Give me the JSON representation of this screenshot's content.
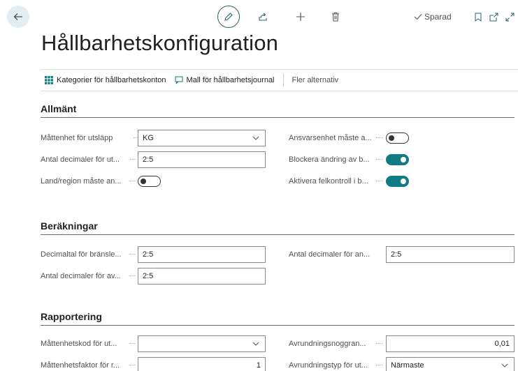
{
  "header": {
    "saved_label": "Sparad",
    "title": "Hållbarhetskonfiguration"
  },
  "actions": {
    "categories": "Kategorier för hållbarhetskonton",
    "template": "Mall för hållbarhetsjournal",
    "more": "Fler alternativ"
  },
  "sections": {
    "general": {
      "title": "Allmänt",
      "emission_unit_label": "Måttenhet för utsläpp",
      "emission_unit_value": "KG",
      "decimals_label": "Antal decimaler för ut...",
      "decimals_value": "2:5",
      "country_label": "Land/region måste an...",
      "country_on": false,
      "responsibility_label": "Ansvarsenhet måste a...",
      "responsibility_on": false,
      "block_label": "Blockera ändring av b...",
      "block_on": true,
      "errorcheck_label": "Aktivera felkontroll i b...",
      "errorcheck_on": true
    },
    "calculations": {
      "title": "Beräkningar",
      "fuel_label": "Decimaltal för bränsle...",
      "fuel_value": "2:5",
      "decimals_an_label": "Antal decimaler för an...",
      "decimals_an_value": "2:5",
      "decimals_av_label": "Antal decimaler för av...",
      "decimals_av_value": "2:5"
    },
    "reporting": {
      "title": "Rapportering",
      "unit_code_label": "Måttenhetskod för ut...",
      "unit_code_value": "",
      "rounding_precision_label": "Avrundningsnoggran...",
      "rounding_precision_value": "0,01",
      "unit_factor_label": "Måttenhetsfaktor för r...",
      "unit_factor_value": "1",
      "rounding_type_label": "Avrundningstyp för ut...",
      "rounding_type_value": "Närmaste"
    }
  },
  "colors": {
    "accent": "#0f7b83",
    "back_button_bg": "#e2eef2"
  }
}
